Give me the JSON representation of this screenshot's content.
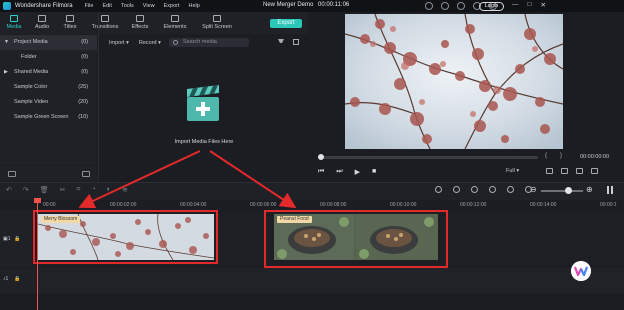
{
  "titlebar": {
    "app_name": "Wondershare Filmora",
    "menu": [
      "File",
      "Edit",
      "Tools",
      "View",
      "Export",
      "Help"
    ],
    "project_title": "New Merger Demo",
    "project_time": "00:00:11:06",
    "login_label": "Login",
    "window_controls": [
      "—",
      "□",
      "✕"
    ]
  },
  "tabs": [
    {
      "label": "Media",
      "icon": "folder-icon",
      "active": true
    },
    {
      "label": "Audio",
      "icon": "music-icon"
    },
    {
      "label": "Titles",
      "icon": "text-icon"
    },
    {
      "label": "Transitions",
      "icon": "transition-icon"
    },
    {
      "label": "Effects",
      "icon": "effects-icon"
    },
    {
      "label": "Elements",
      "icon": "elements-icon"
    },
    {
      "label": "Split Screen",
      "icon": "split-screen-icon"
    }
  ],
  "export_label": "Export",
  "sidebar": {
    "items": [
      {
        "label": "Project Media",
        "count": "(0)"
      },
      {
        "label": "Folder",
        "count": "(0)"
      },
      {
        "label": "Shared Media",
        "count": "(0)"
      },
      {
        "label": "Sample Color",
        "count": "(25)"
      },
      {
        "label": "Sample Video",
        "count": "(20)"
      },
      {
        "label": "Sample Green Screen",
        "count": "(10)"
      }
    ]
  },
  "mediabar": {
    "import_label": "Import",
    "record_label": "Record",
    "search_placeholder": "Search media"
  },
  "media_area": {
    "import_label": "Import Media Files Here"
  },
  "preview": {
    "bracket_open": "{",
    "bracket_close": "}",
    "time": "00:00:00:00",
    "quality": "Full",
    "controls": [
      "⏮",
      "⏭",
      "▶",
      "■"
    ]
  },
  "ruler": {
    "ticks": [
      "00:00",
      "00:00:02:00",
      "00:00:04:00",
      "00:00:06:00",
      "00:00:08:00",
      "00:00:10:00",
      "00:00:12:00",
      "00:00:14:00",
      "00:00:1"
    ]
  },
  "clips": [
    {
      "label": "Merry Blossom"
    },
    {
      "label": "Peanut Food"
    }
  ],
  "tracks": {
    "video_label": "1",
    "audio_label": "1"
  },
  "colors": {
    "accent": "#2bc7b9",
    "highlight": "#e32a2a",
    "playhead": "#f0524e"
  }
}
